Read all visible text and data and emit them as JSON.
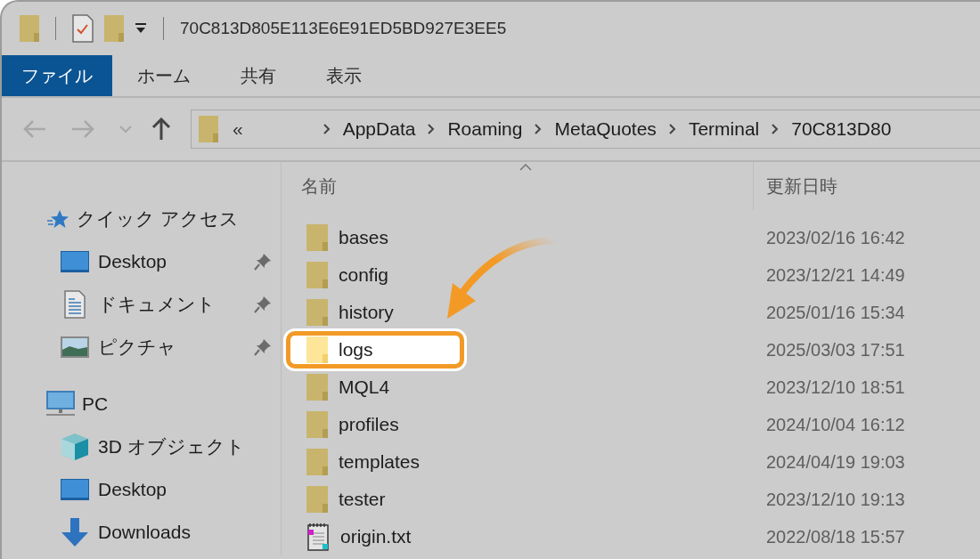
{
  "window": {
    "title": "70C813D805E113E6E91ED5BD927E3EE5"
  },
  "ribbon_tabs": [
    {
      "label": "ファイル",
      "selected": true
    },
    {
      "label": "ホーム",
      "selected": false
    },
    {
      "label": "共有",
      "selected": false
    },
    {
      "label": "表示",
      "selected": false
    }
  ],
  "nav_buttons": [
    {
      "kind": "back",
      "disabled": true
    },
    {
      "kind": "forward",
      "disabled": true
    },
    {
      "kind": "recent",
      "disabled": true
    },
    {
      "kind": "up",
      "disabled": false
    }
  ],
  "address_bar": {
    "overflow_marker": "«",
    "path": [
      "AppData",
      "Roaming",
      "MetaQuotes",
      "Terminal",
      "70C813D80"
    ]
  },
  "sidebar": [
    {
      "label": "クイック アクセス",
      "kind": "quick-access",
      "children": [
        {
          "label": "Desktop",
          "kind": "desktop",
          "pinned": true
        },
        {
          "label": "ドキュメント",
          "kind": "documents",
          "pinned": true
        },
        {
          "label": "ピクチャ",
          "kind": "pictures",
          "pinned": true
        }
      ]
    },
    {
      "label": "PC",
      "kind": "pc",
      "children": [
        {
          "label": "3D オブジェクト",
          "kind": "objects3d",
          "pinned": false
        },
        {
          "label": "Desktop",
          "kind": "desktop",
          "pinned": false
        },
        {
          "label": "Downloads",
          "kind": "downloads",
          "pinned": false
        }
      ]
    }
  ],
  "columns": [
    {
      "label": "名前",
      "sorted": true
    },
    {
      "label": "更新日時",
      "sorted": false
    }
  ],
  "files": [
    {
      "name": "bases",
      "kind": "folder",
      "modified": "2023/02/16 16:42",
      "highlighted": false
    },
    {
      "name": "config",
      "kind": "folder",
      "modified": "2023/12/21 14:49",
      "highlighted": false
    },
    {
      "name": "history",
      "kind": "folder",
      "modified": "2025/01/16 15:34",
      "highlighted": false
    },
    {
      "name": "logs",
      "kind": "folder",
      "modified": "2025/03/03 17:51",
      "highlighted": true
    },
    {
      "name": "MQL4",
      "kind": "folder",
      "modified": "2023/12/10 18:51",
      "highlighted": false
    },
    {
      "name": "profiles",
      "kind": "folder",
      "modified": "2024/10/04 16:12",
      "highlighted": false
    },
    {
      "name": "templates",
      "kind": "folder",
      "modified": "2024/04/19 19:03",
      "highlighted": false
    },
    {
      "name": "tester",
      "kind": "folder",
      "modified": "2023/12/10 19:13",
      "highlighted": false
    },
    {
      "name": "origin.txt",
      "kind": "text",
      "modified": "2022/08/18 15:57",
      "highlighted": false
    }
  ]
}
